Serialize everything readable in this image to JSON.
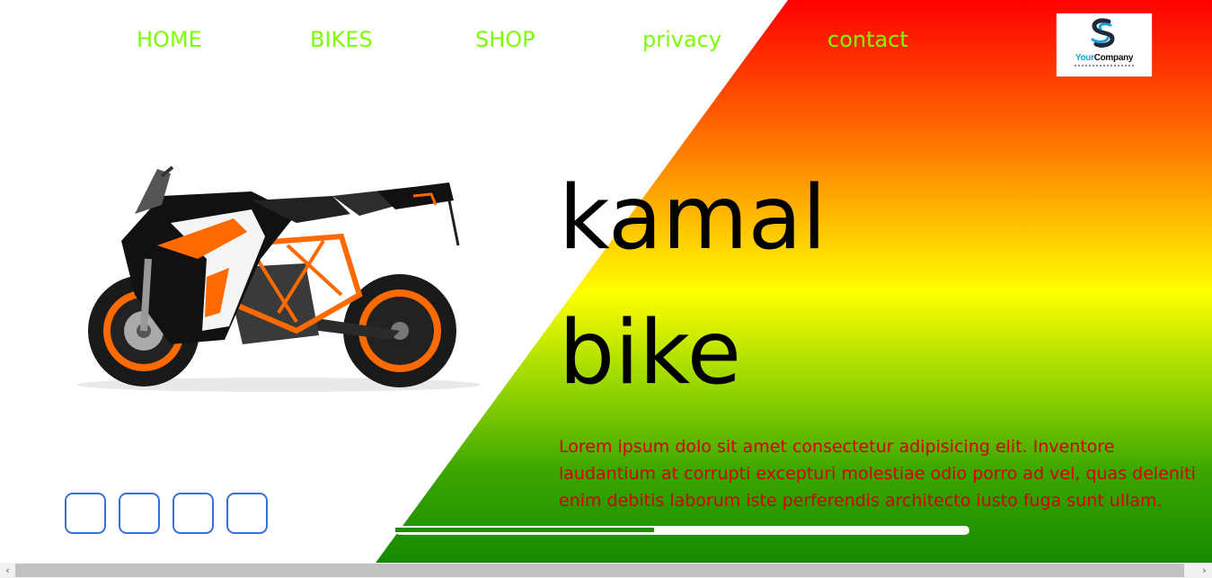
{
  "nav": {
    "items": [
      {
        "label": "HOME"
      },
      {
        "label": "BIKES"
      },
      {
        "label": "SHOP"
      },
      {
        "label": "privacy"
      },
      {
        "label": "contact"
      }
    ]
  },
  "logo": {
    "brand_part1": "Your",
    "brand_part2": "Company"
  },
  "hero": {
    "title_line1": "kamal",
    "title_line2": "bike",
    "description": "Lorem ipsum dolo sit amet consectetur adipisicing elit. Inventore laudantium at corrupti excepturi molestiae odio porro ad vel, quas deleniti enim debitis laborum iste perferendis architecto iusto fuga sunt ullam."
  },
  "slider": {
    "dot_count": 4,
    "progress_fraction": 0.45
  },
  "colors": {
    "nav_text": "#7cfc00",
    "description_text": "#d40000",
    "dot_border": "#3a6fd8",
    "progress_fill": "#1a8f00",
    "gradient_top": "#ff0000",
    "gradient_middle": "#ffff00",
    "gradient_bottom": "#158a00"
  },
  "scrollbar": {
    "left_icon": "chevron-left-icon",
    "right_icon": "chevron-right-icon"
  }
}
